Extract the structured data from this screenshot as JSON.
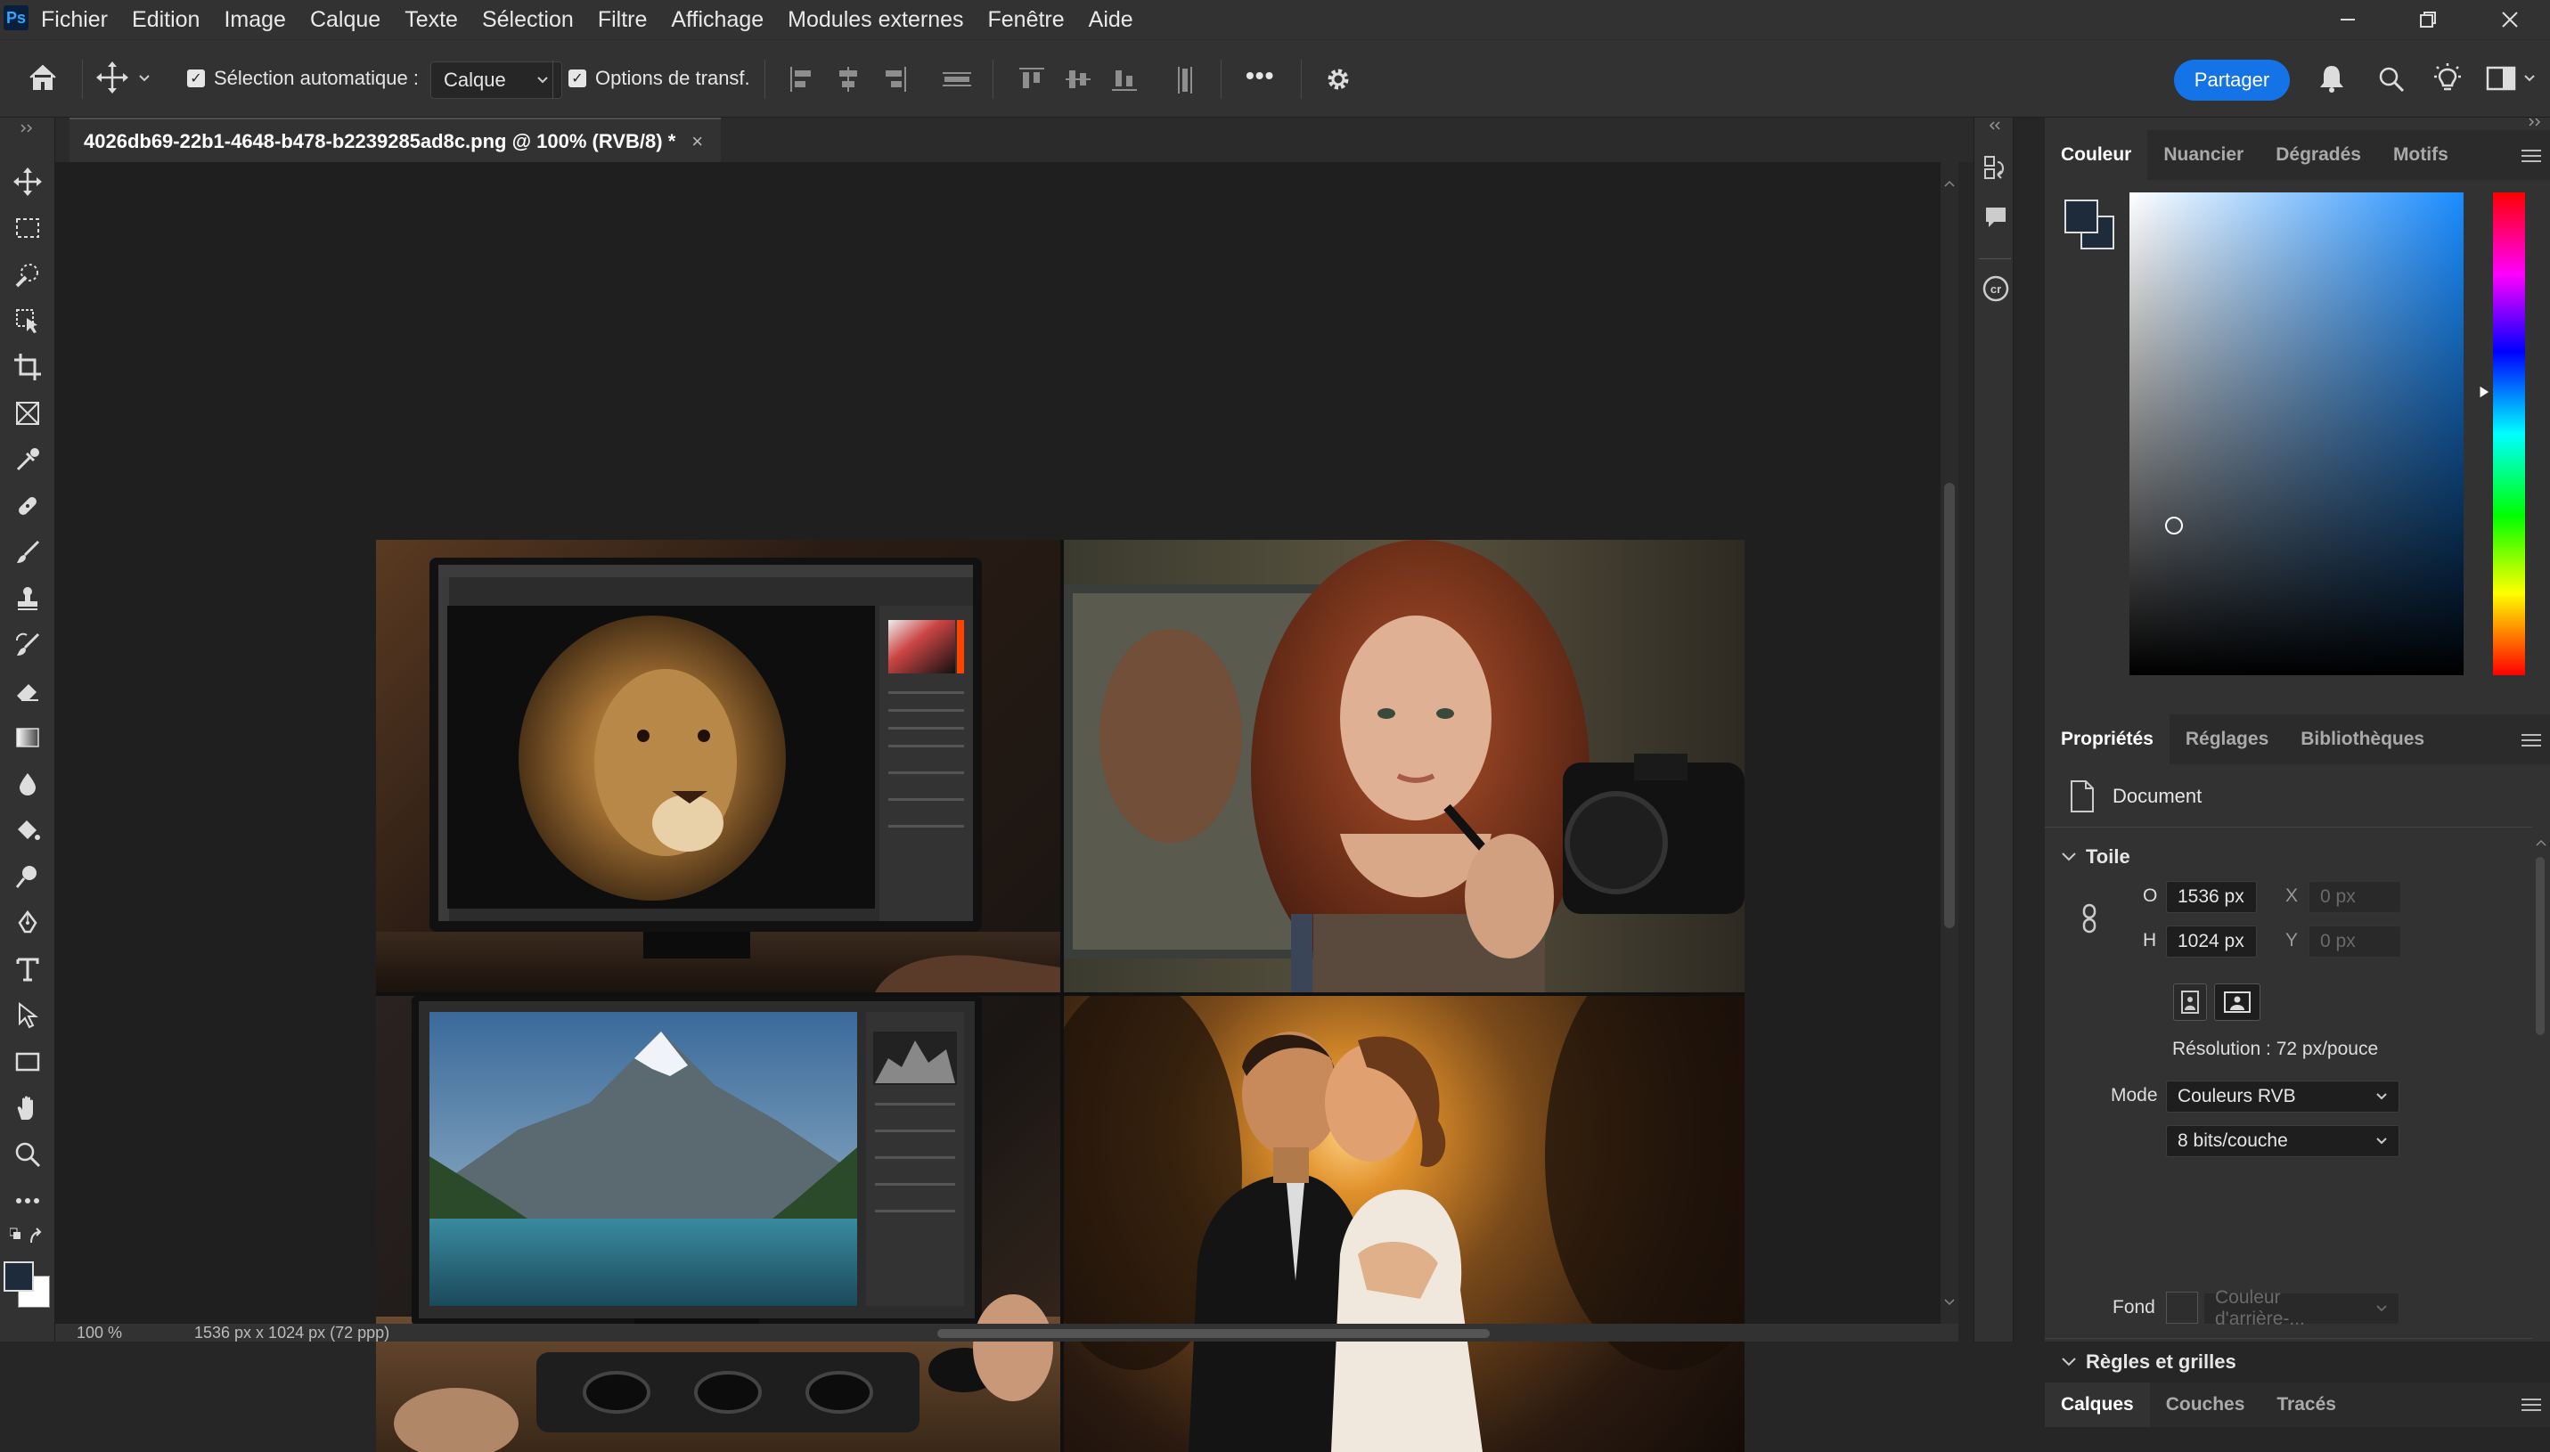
{
  "app": {
    "logo": "Ps",
    "menu": [
      "Fichier",
      "Edition",
      "Image",
      "Calque",
      "Texte",
      "Sélection",
      "Filtre",
      "Affichage",
      "Modules externes",
      "Fenêtre",
      "Aide"
    ]
  },
  "options": {
    "auto_select_label": "Sélection automatique :",
    "auto_select_checked": true,
    "auto_select_target": "Calque",
    "transform_label": "Options de transf.",
    "transform_checked": true,
    "more": "•••",
    "share": "Partager"
  },
  "document": {
    "tab_title": "4026db69-22b1-4648-b478-b2239285ad8c.png @ 100% (RVB/8) *",
    "close": "×"
  },
  "status": {
    "zoom": "100 %",
    "info": "1536 px x 1024 px (72 ppp)"
  },
  "color_panel": {
    "tabs": [
      "Couleur",
      "Nuancier",
      "Dégradés",
      "Motifs"
    ],
    "active_tab": "Couleur",
    "foreground": "#1d2b3a",
    "background": "#ffffff",
    "hue_color": "#1a8cff"
  },
  "properties_panel": {
    "tabs": [
      "Propriétés",
      "Réglages",
      "Bibliothèques"
    ],
    "active_tab": "Propriétés",
    "kind": "Document",
    "section_canvas": "Toile",
    "width_label": "O",
    "width_value": "1536 px",
    "height_label": "H",
    "height_value": "1024 px",
    "x_label": "X",
    "x_placeholder": "0 px",
    "y_label": "Y",
    "y_placeholder": "0 px",
    "resolution": "Résolution : 72 px/pouce",
    "mode_label": "Mode",
    "mode_value": "Couleurs RVB",
    "depth_value": "8 bits/couche",
    "fill_label": "Fond",
    "fill_value": "Couleur d'arrière-...",
    "section_rulers": "Règles et grilles"
  },
  "layers_panel": {
    "tabs": [
      "Calques",
      "Couches",
      "Tracés"
    ],
    "active_tab": "Calques"
  }
}
